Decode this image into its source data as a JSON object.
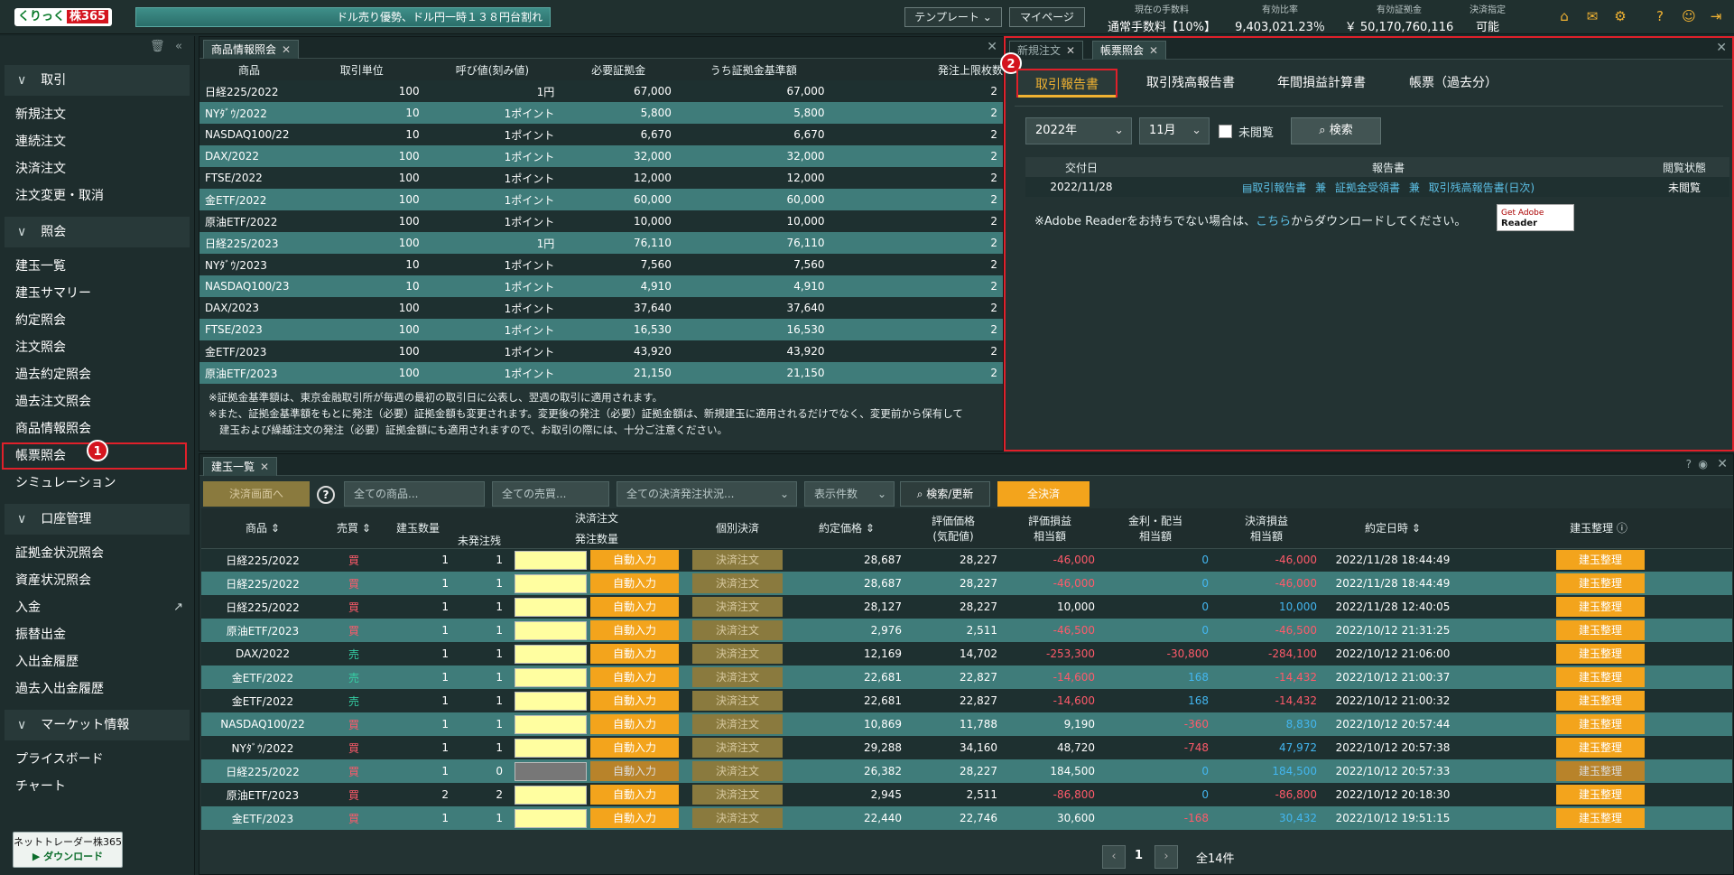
{
  "header": {
    "logo_main": "くりっく",
    "logo_red": "株365",
    "ticker": "ドル売り優勢、ドル円一時１３８円台割れ",
    "template_btn": "テンプレート",
    "mypage_btn": "マイページ",
    "fee_label": "現在の手数料",
    "fee_value": "通常手数料【10%】",
    "ratio_label": "有効比率",
    "ratio_value": "9,403,021.23％",
    "margin_label": "有効証拠金",
    "margin_value": "￥ 50,170,760,116",
    "settle_label": "決済指定",
    "settle_value": "可能"
  },
  "sidebar": {
    "sections": [
      {
        "title": "取引",
        "items": [
          "新規注文",
          "連続注文",
          "決済注文",
          "注文変更・取消"
        ]
      },
      {
        "title": "照会",
        "items": [
          "建玉一覧",
          "建玉サマリー",
          "約定照会",
          "注文照会",
          "過去約定照会",
          "過去注文照会",
          "商品情報照会",
          "帳票照会",
          "シミュレーション"
        ]
      },
      {
        "title": "口座管理",
        "items": [
          "証拠金状況照会",
          "資産状況照会",
          "入金",
          "振替出金",
          "入出金履歴",
          "過去入出金履歴"
        ]
      },
      {
        "title": "マーケット情報",
        "items": [
          "プライスボード",
          "チャート"
        ]
      }
    ],
    "badge1": "1",
    "download_label": "ネットトレーダー株365",
    "download_btn": "ダウンロード"
  },
  "product_panel": {
    "tab": "商品情報照会",
    "headers": [
      "商品",
      "取引単位",
      "呼び値(刻み値)",
      "必要証拠金",
      "うち証拠金基準額",
      "発注上限枚数"
    ],
    "rows": [
      [
        "日経225/2022",
        "100",
        "1円",
        "67,000",
        "67,000",
        "2"
      ],
      [
        "NYﾀﾞｳ/2022",
        "10",
        "1ポイント",
        "5,800",
        "5,800",
        "2"
      ],
      [
        "NASDAQ100/22",
        "10",
        "1ポイント",
        "6,670",
        "6,670",
        "2"
      ],
      [
        "DAX/2022",
        "100",
        "1ポイント",
        "32,000",
        "32,000",
        "2"
      ],
      [
        "FTSE/2022",
        "100",
        "1ポイント",
        "12,000",
        "12,000",
        "2"
      ],
      [
        "金ETF/2022",
        "100",
        "1ポイント",
        "60,000",
        "60,000",
        "2"
      ],
      [
        "原油ETF/2022",
        "100",
        "1ポイント",
        "10,000",
        "10,000",
        "2"
      ],
      [
        "日経225/2023",
        "100",
        "1円",
        "76,110",
        "76,110",
        "2"
      ],
      [
        "NYﾀﾞｳ/2023",
        "10",
        "1ポイント",
        "7,560",
        "7,560",
        "2"
      ],
      [
        "NASDAQ100/23",
        "10",
        "1ポイント",
        "4,910",
        "4,910",
        "2"
      ],
      [
        "DAX/2023",
        "100",
        "1ポイント",
        "37,640",
        "37,640",
        "2"
      ],
      [
        "FTSE/2023",
        "100",
        "1ポイント",
        "16,530",
        "16,530",
        "2"
      ],
      [
        "金ETF/2023",
        "100",
        "1ポイント",
        "43,920",
        "43,920",
        "2"
      ],
      [
        "原油ETF/2023",
        "100",
        "1ポイント",
        "21,150",
        "21,150",
        "2"
      ]
    ],
    "note1": "※証拠金基準額は、東京金融取引所が毎週の最初の取引日に公表し、翌週の取引に適用されます。",
    "note2": "※また、証拠金基準額をもとに発注（必要）証拠金額も変更されます。変更後の発注（必要）証拠金額は、新規建玉に適用されるだけでなく、変更前から保有して",
    "note3": "建玉および繰越注文の発注（必要）証拠金額にも適用されますので、お取引の際には、十分ご注意ください。"
  },
  "report_panel": {
    "tab_dim": "新規注文",
    "tab": "帳票照会",
    "badge2": "2",
    "subtabs": [
      "取引報告書",
      "取引残高報告書",
      "年間損益計算書",
      "帳票（過去分）"
    ],
    "year": "2022年",
    "month": "11月",
    "unread_label": "未閲覧",
    "search_btn": "検索",
    "headers": [
      "交付日",
      "報告書",
      "閲覧状態"
    ],
    "row": {
      "date": "2022/11/28",
      "r1": "取引報告書",
      "and1": "兼",
      "r2": "証拠金受領書",
      "and2": "兼",
      "r3": "取引残高報告書(日次)",
      "status": "未閲覧"
    },
    "adobe_pre": "※Adobe Readerをお持ちでない場合は、",
    "adobe_link": "こちら",
    "adobe_post": "からダウンロードしてください。",
    "adobe_badge1": "Get Adobe",
    "adobe_badge2": "Reader"
  },
  "positions_panel": {
    "tab": "建玉一覧",
    "toolbar": {
      "settle_screen": "決済画面へ",
      "all_products": "全ての商品...",
      "all_trades": "全ての売買...",
      "all_status": "全ての決済発注状況...",
      "display_count": "表示件数",
      "search_update": "検索/更新",
      "settle_all": "全決済"
    },
    "headers": {
      "product": "商品",
      "side": "売買",
      "qty": "建玉数量",
      "unordered": "未発注残",
      "settle_order": "決済注文",
      "order_qty": "発注数量",
      "indiv": "個別決済",
      "price": "約定価格",
      "eval_price1": "評価価格",
      "eval_price2": "(気配値)",
      "eval_pl1": "評価損益",
      "eval_pl2": "相当額",
      "interest1": "金利・配当",
      "interest2": "相当額",
      "settle_pl1": "決済損益",
      "settle_pl2": "相当額",
      "datetime": "約定日時",
      "arrange": "建玉整理"
    },
    "auto_label": "自動入力",
    "settle_label": "決済注文",
    "arrange_label": "建玉整理",
    "rows": [
      [
        "日経225/2022",
        "買",
        "1",
        "1",
        "28,687",
        "28,227",
        "-46,000",
        "0",
        "-46,000",
        "2022/11/28 18:44:49"
      ],
      [
        "日経225/2022",
        "買",
        "1",
        "1",
        "28,687",
        "28,227",
        "-46,000",
        "0",
        "-46,000",
        "2022/11/28 18:44:49"
      ],
      [
        "日経225/2022",
        "買",
        "1",
        "1",
        "28,127",
        "28,227",
        "10,000",
        "0",
        "10,000",
        "2022/11/28 12:40:05"
      ],
      [
        "原油ETF/2023",
        "買",
        "1",
        "1",
        "2,976",
        "2,511",
        "-46,500",
        "0",
        "-46,500",
        "2022/10/12 21:31:25"
      ],
      [
        "DAX/2022",
        "売",
        "1",
        "1",
        "12,169",
        "14,702",
        "-253,300",
        "-30,800",
        "-284,100",
        "2022/10/12 21:06:00"
      ],
      [
        "金ETF/2022",
        "売",
        "1",
        "1",
        "22,681",
        "22,827",
        "-14,600",
        "168",
        "-14,432",
        "2022/10/12 21:00:37"
      ],
      [
        "金ETF/2022",
        "売",
        "1",
        "1",
        "22,681",
        "22,827",
        "-14,600",
        "168",
        "-14,432",
        "2022/10/12 21:00:32"
      ],
      [
        "NASDAQ100/22",
        "買",
        "1",
        "1",
        "10,869",
        "11,788",
        "9,190",
        "-360",
        "8,830",
        "2022/10/12 20:57:44"
      ],
      [
        "NYﾀﾞｳ/2022",
        "買",
        "1",
        "1",
        "29,288",
        "34,160",
        "48,720",
        "-748",
        "47,972",
        "2022/10/12 20:57:38"
      ],
      [
        "日経225/2022",
        "買",
        "1",
        "0",
        "26,382",
        "28,227",
        "184,500",
        "0",
        "184,500",
        "2022/10/12 20:57:33"
      ],
      [
        "原油ETF/2023",
        "買",
        "2",
        "2",
        "2,945",
        "2,511",
        "-86,800",
        "0",
        "-86,800",
        "2022/10/12 20:18:30"
      ],
      [
        "金ETF/2023",
        "買",
        "1",
        "1",
        "22,440",
        "22,746",
        "30,600",
        "-168",
        "30,432",
        "2022/10/12 19:51:15"
      ]
    ],
    "page": "1",
    "total": "全14件"
  }
}
